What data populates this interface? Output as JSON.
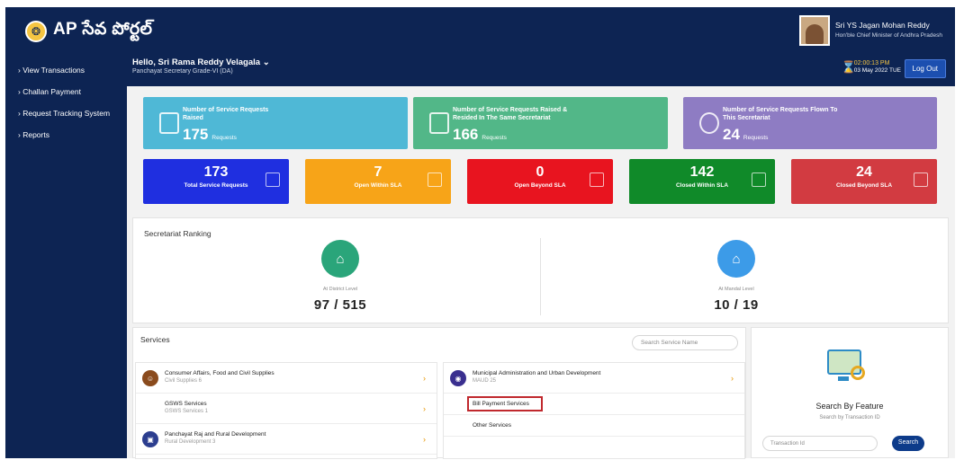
{
  "header": {
    "app_title": "AP సేవ పోర్టల్",
    "user_name": "Sri YS Jagan Mohan Reddy",
    "user_title": "Hon'ble Chief Minister of Andhra Pradesh"
  },
  "sidebar": {
    "items": [
      {
        "label": "View Transactions"
      },
      {
        "label": "Challan Payment"
      },
      {
        "label": "Request Tracking System"
      },
      {
        "label": "Reports"
      }
    ]
  },
  "subheader": {
    "greeting": "Hello, Sri Rama Reddy Velagala",
    "role": "Panchayat Secretary Grade-VI (DA)",
    "time": "02:00:13 PM",
    "date": "03 May 2022 TUE",
    "logout_label": "Log Out"
  },
  "summary_cards": [
    {
      "label": "Number of Service Requests Raised",
      "value": "175",
      "unit": "Requests",
      "color": "#4fb8d6"
    },
    {
      "label": "Number of Service Requests Raised & Resided In The Same Secretariat",
      "value": "166",
      "unit": "Requests",
      "color": "#52b788"
    },
    {
      "label": "Number of Service Requests Flown To This Secretariat",
      "value": "24",
      "unit": "Requests",
      "color": "#8e7cc3"
    }
  ],
  "stats": [
    {
      "value": "173",
      "label": "Total Service Requests",
      "color": "#1f2fe0"
    },
    {
      "value": "7",
      "label": "Open Within SLA",
      "color": "#f7a418"
    },
    {
      "value": "0",
      "label": "Open Beyond SLA",
      "color": "#e8141f"
    },
    {
      "value": "142",
      "label": "Closed Within SLA",
      "color": "#108a29"
    },
    {
      "value": "24",
      "label": "Closed Beyond SLA",
      "color": "#d23b41"
    }
  ],
  "ranking": {
    "title": "Secretariat Ranking",
    "district_level_label": "At District Level",
    "district_value": "97 / 515",
    "mandal_level_label": "At Mandal Level",
    "mandal_value": "10 / 19"
  },
  "services": {
    "title": "Services",
    "search_placeholder": "Search Service Name",
    "left": [
      {
        "title": "Consumer Affairs, Food and Civil Supplies",
        "sub": "Civil Supplies 6"
      },
      {
        "title": "GSWS Services",
        "sub": "GSWS Services 1"
      },
      {
        "title": "Panchayat Raj and Rural Development",
        "sub": "Rural Development 3"
      }
    ],
    "right_header": {
      "title": "Municipal Administration and Urban Development",
      "sub": "MAUD 25"
    },
    "right_sub": [
      {
        "label": "Bill Payment Services"
      },
      {
        "label": "Other Services"
      }
    ]
  },
  "feature": {
    "title": "Search By Feature",
    "subtitle": "Search by Transaction ID",
    "input_placeholder": "Transaction Id",
    "button_label": "Search"
  }
}
